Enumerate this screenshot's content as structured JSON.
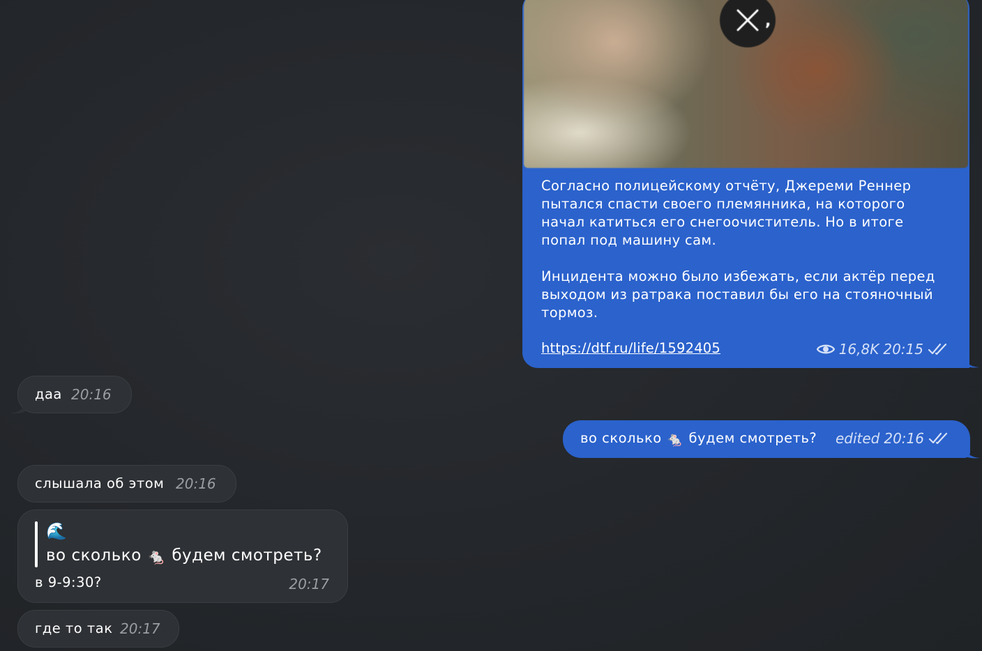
{
  "channel_post": {
    "text": "Согласно полицейскому отчёту, Джереми Реннер пытался спасти своего племянника, на которого начал катиться его снегоочиститель. Но в итоге попал под машину сам.\n\nИнцидента можно было избежать, если актёр перед выходом из ратрака поставил бы его на стояночный тормоз.",
    "link": "https://dtf.ru/life/1592405",
    "views": "16,8K",
    "time": "20:15",
    "media_close_icon": "close-icon",
    "media_overlay_char": ","
  },
  "messages": [
    {
      "id": "m1",
      "direction": "in",
      "text": "даа",
      "time": "20:16"
    },
    {
      "id": "m2",
      "direction": "out",
      "text_before": "во сколько",
      "emoji": "🐁",
      "text_after": "будем смотреть?",
      "edited_label": "edited",
      "time": "20:16"
    },
    {
      "id": "m3",
      "direction": "in",
      "text": "слышала об этом",
      "time": "20:16"
    },
    {
      "id": "m4",
      "direction": "in",
      "reply": {
        "author_emoji": "🌊",
        "text_before": "во сколько",
        "emoji": "🐁",
        "text_after": "будем смотреть?"
      },
      "text": "в 9-9:30?",
      "time": "20:17"
    },
    {
      "id": "m5",
      "direction": "in",
      "text": "где то так",
      "time": "20:17"
    }
  ],
  "colors": {
    "background": "#23262a",
    "incoming_bubble": "#2e3135",
    "outgoing_bubble": "#2b62cc",
    "time_incoming": "#9a9ea4",
    "time_outgoing": "#d5e0f6"
  },
  "icons": {
    "views": "eye-icon",
    "read_status": "double-check-icon"
  }
}
